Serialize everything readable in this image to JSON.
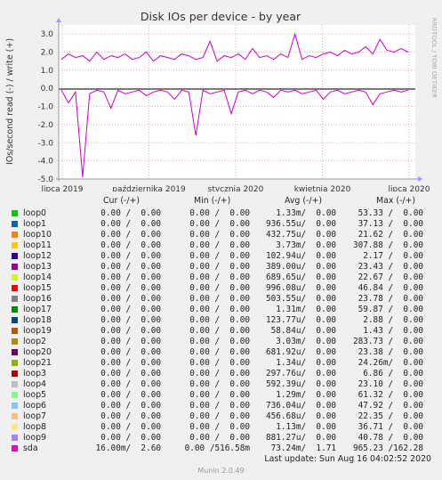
{
  "chart_data": {
    "type": "line",
    "title": "Disk IOs per device - by year",
    "ylabel": "IOs/second read (-) / write (+)",
    "side_label": "RRDTOOL / TOBI OETIKER",
    "ylim": [
      -5.0,
      3.5
    ],
    "yticks": [
      "3.0",
      "2.0",
      "1.0",
      "0.0",
      "-1.0",
      "-2.0",
      "-3.0",
      "-4.0",
      "-5.0"
    ],
    "xticks": [
      "lipca 2019",
      "października 2019",
      "stycznia 2020",
      "kwietnia 2020",
      "lipca 2020"
    ],
    "grid": true,
    "series": [
      {
        "name": "sda",
        "color": "#cc00cc",
        "write_values": [
          1.6,
          1.9,
          1.7,
          1.8,
          1.5,
          2.0,
          1.6,
          1.8,
          1.7,
          1.9,
          1.6,
          1.7,
          2.0,
          1.5,
          1.8,
          1.7,
          1.6,
          1.9,
          1.8,
          1.6,
          1.7,
          2.6,
          1.5,
          1.8,
          1.7,
          1.9,
          1.6,
          2.2,
          1.7,
          1.8,
          1.6,
          1.9,
          1.7,
          3.0,
          1.6,
          1.8,
          1.7,
          1.9,
          2.0,
          1.8,
          2.1,
          1.9,
          2.0,
          2.3,
          1.9,
          2.7,
          2.1,
          2.0,
          2.2,
          2.0
        ],
        "read_values": [
          -0.1,
          -0.8,
          -0.2,
          -4.9,
          -0.3,
          -0.1,
          -0.2,
          -1.1,
          -0.1,
          -0.3,
          -0.2,
          -0.1,
          -0.4,
          -0.2,
          -0.1,
          -0.2,
          -0.6,
          -0.1,
          -0.2,
          -2.6,
          -0.1,
          -0.3,
          -0.2,
          -0.1,
          -1.4,
          -0.2,
          -0.1,
          -0.3,
          -0.1,
          -0.2,
          -0.5,
          -0.1,
          -0.2,
          -0.1,
          -0.3,
          -0.2,
          -0.1,
          -0.6,
          -0.2,
          -0.1,
          -0.3,
          -0.2,
          -0.1,
          -0.2,
          -0.9,
          -0.3,
          -0.2,
          -0.1,
          -0.2,
          -0.1
        ]
      }
    ]
  },
  "legend": {
    "headers": {
      "cur": "Cur (-/+)",
      "min": "Min (-/+)",
      "avg": "Avg (-/+)",
      "max": "Max (-/+)"
    },
    "rows": [
      {
        "name": "loop0",
        "color": "#00cc00",
        "cur": "0.00 /  0.00",
        "min": "0.00 /  0.00",
        "avg": "1.33m/  0.00",
        "max": "53.33 /  0.00"
      },
      {
        "name": "loop1",
        "color": "#0066b3",
        "cur": "0.00 /  0.00",
        "min": "0.00 /  0.00",
        "avg": "936.55u/  0.00",
        "max": "37.13 /  0.00"
      },
      {
        "name": "loop10",
        "color": "#ff8000",
        "cur": "0.00 /  0.00",
        "min": "0.00 /  0.00",
        "avg": "432.75u/  0.00",
        "max": "21.62 /  0.00"
      },
      {
        "name": "loop11",
        "color": "#ffcc00",
        "cur": "0.00 /  0.00",
        "min": "0.00 /  0.00",
        "avg": "3.73m/  0.00",
        "max": "307.88 /  0.00"
      },
      {
        "name": "loop12",
        "color": "#330099",
        "cur": "0.00 /  0.00",
        "min": "0.00 /  0.00",
        "avg": "102.94u/  0.00",
        "max": "2.17 /  0.00"
      },
      {
        "name": "loop13",
        "color": "#990099",
        "cur": "0.00 /  0.00",
        "min": "0.00 /  0.00",
        "avg": "389.00u/  0.00",
        "max": "23.43 /  0.00"
      },
      {
        "name": "loop14",
        "color": "#ccff00",
        "cur": "0.00 /  0.00",
        "min": "0.00 /  0.00",
        "avg": "689.65u/  0.00",
        "max": "22.67 /  0.00"
      },
      {
        "name": "loop15",
        "color": "#ff0000",
        "cur": "0.00 /  0.00",
        "min": "0.00 /  0.00",
        "avg": "996.08u/  0.00",
        "max": "46.84 /  0.00"
      },
      {
        "name": "loop16",
        "color": "#808080",
        "cur": "0.00 /  0.00",
        "min": "0.00 /  0.00",
        "avg": "503.55u/  0.00",
        "max": "23.78 /  0.00"
      },
      {
        "name": "loop17",
        "color": "#008f00",
        "cur": "0.00 /  0.00",
        "min": "0.00 /  0.00",
        "avg": "1.31m/  0.00",
        "max": "59.87 /  0.00"
      },
      {
        "name": "loop18",
        "color": "#00487d",
        "cur": "0.00 /  0.00",
        "min": "0.00 /  0.00",
        "avg": "123.77u/  0.00",
        "max": "2.88 /  0.00"
      },
      {
        "name": "loop19",
        "color": "#b35a00",
        "cur": "0.00 /  0.00",
        "min": "0.00 /  0.00",
        "avg": "58.84u/  0.00",
        "max": "1.43 /  0.00"
      },
      {
        "name": "loop2",
        "color": "#b38f00",
        "cur": "0.00 /  0.00",
        "min": "0.00 /  0.00",
        "avg": "3.03m/  0.00",
        "max": "283.73 /  0.00"
      },
      {
        "name": "loop20",
        "color": "#6b006b",
        "cur": "0.00 /  0.00",
        "min": "0.00 /  0.00",
        "avg": "681.92u/  0.00",
        "max": "23.38 /  0.00"
      },
      {
        "name": "loop21",
        "color": "#8fb300",
        "cur": "0.00 /  0.00",
        "min": "0.00 /  0.00",
        "avg": "1.34u/  0.00",
        "max": "24.26m/  0.00"
      },
      {
        "name": "loop3",
        "color": "#b30000",
        "cur": "0.00 /  0.00",
        "min": "0.00 /  0.00",
        "avg": "297.76u/  0.00",
        "max": "6.86 /  0.00"
      },
      {
        "name": "loop4",
        "color": "#bebebe",
        "cur": "0.00 /  0.00",
        "min": "0.00 /  0.00",
        "avg": "592.39u/  0.00",
        "max": "23.10 /  0.00"
      },
      {
        "name": "loop5",
        "color": "#80ff80",
        "cur": "0.00 /  0.00",
        "min": "0.00 /  0.00",
        "avg": "1.29m/  0.00",
        "max": "61.32 /  0.00"
      },
      {
        "name": "loop6",
        "color": "#80c9ff",
        "cur": "0.00 /  0.00",
        "min": "0.00 /  0.00",
        "avg": "736.04u/  0.00",
        "max": "47.92 /  0.00"
      },
      {
        "name": "loop7",
        "color": "#ffc080",
        "cur": "0.00 /  0.00",
        "min": "0.00 /  0.00",
        "avg": "456.68u/  0.00",
        "max": "22.35 /  0.00"
      },
      {
        "name": "loop8",
        "color": "#ffe680",
        "cur": "0.00 /  0.00",
        "min": "0.00 /  0.00",
        "avg": "1.13m/  0.00",
        "max": "36.71 /  0.00"
      },
      {
        "name": "loop9",
        "color": "#aa80ff",
        "cur": "0.00 /  0.00",
        "min": "0.00 /  0.00",
        "avg": "881.27u/  0.00",
        "max": "40.78 /  0.00"
      },
      {
        "name": "sda",
        "color": "#ee00cc",
        "cur": "16.00m/  2.60",
        "min": "0.00 /516.58m",
        "avg": "73.24m/  1.71",
        "max": "965.23 /162.28"
      }
    ]
  },
  "footer": {
    "last_update": "Last update: Sun Aug 16 04:02:52 2020",
    "generator": "Munin 2.0.49"
  }
}
